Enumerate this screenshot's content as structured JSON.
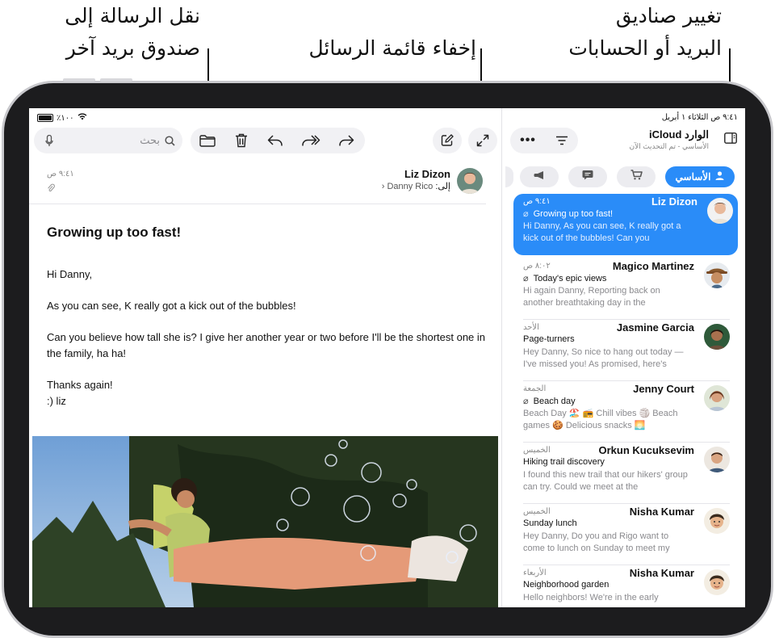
{
  "callouts": {
    "move_line1": "نقل الرسالة إلى",
    "move_line2": "صندوق بريد آخر",
    "hide_list": "إخفاء قائمة الرسائل",
    "change_line1": "تغيير صناديق",
    "change_line2": "البريد أو الحسابات"
  },
  "status": {
    "battery": "٪١٠٠",
    "time_date": "٩:٤١ ص  الثلاثاء ١ أبريل"
  },
  "toolbar": {
    "search_placeholder": "بحث"
  },
  "mailbox": {
    "title": "الوارد iCloud",
    "subtitle": "الأساسي - تم التحديث الآن",
    "primary_label": "الأساسي"
  },
  "message": {
    "sender": "Liz Dizon",
    "time": "٩:٤١ ص",
    "to_label": "إلى:",
    "to_name": "Danny Rico",
    "subject": "Growing up too fast!",
    "body": [
      "Hi Danny,",
      "As you can see, K really got a kick out of the bubbles!",
      "Can you believe how tall she is? I give her another year or two before I'll be the shortest one in",
      "the family, ha ha!",
      "Thanks again!",
      ":) liz"
    ]
  },
  "list": [
    {
      "sender": "Liz Dizon",
      "time": "٩:٤١ ص",
      "subject": "Growing up too fast!",
      "preview": "Hi Danny, As you can see, K really got a kick out of the bubbles! Can you",
      "attachment": true,
      "selected": true
    },
    {
      "sender": "Magico Martinez",
      "time": "٨:٠٢ ص",
      "subject": "Today's epic views",
      "preview": "Hi again Danny, Reporting back on another breathtaking day in the",
      "attachment": true
    },
    {
      "sender": "Jasmine Garcia",
      "time": "الأحد",
      "subject": "Page-turners",
      "preview": "Hey Danny, So nice to hang out today —I've missed you! As promised, here's",
      "attachment": false
    },
    {
      "sender": "Jenny Court",
      "time": "الجمعة",
      "subject": "Beach day",
      "preview": "Beach Day 🏖️ 📻 Chill vibes 🏐 Beach games 🍪 Delicious snacks 🌅",
      "attachment": true
    },
    {
      "sender": "Orkun Kucuksevim",
      "time": "الخميس",
      "subject": "Hiking trail discovery",
      "preview": "I found this new trail that our hikers' group can try. Could we meet at the",
      "attachment": false
    },
    {
      "sender": "Nisha Kumar",
      "time": "الخميس",
      "subject": "Sunday lunch",
      "preview": "Hey Danny, Do you and Rigo want to come to lunch on Sunday to meet my",
      "attachment": false
    },
    {
      "sender": "Nisha Kumar",
      "time": "الأربعاء",
      "subject": "Neighborhood garden",
      "preview": "Hello neighbors! We're in the early",
      "attachment": false
    }
  ],
  "colors": {
    "accent": "#2a8cf8",
    "bezel": "#1c1c1e"
  }
}
